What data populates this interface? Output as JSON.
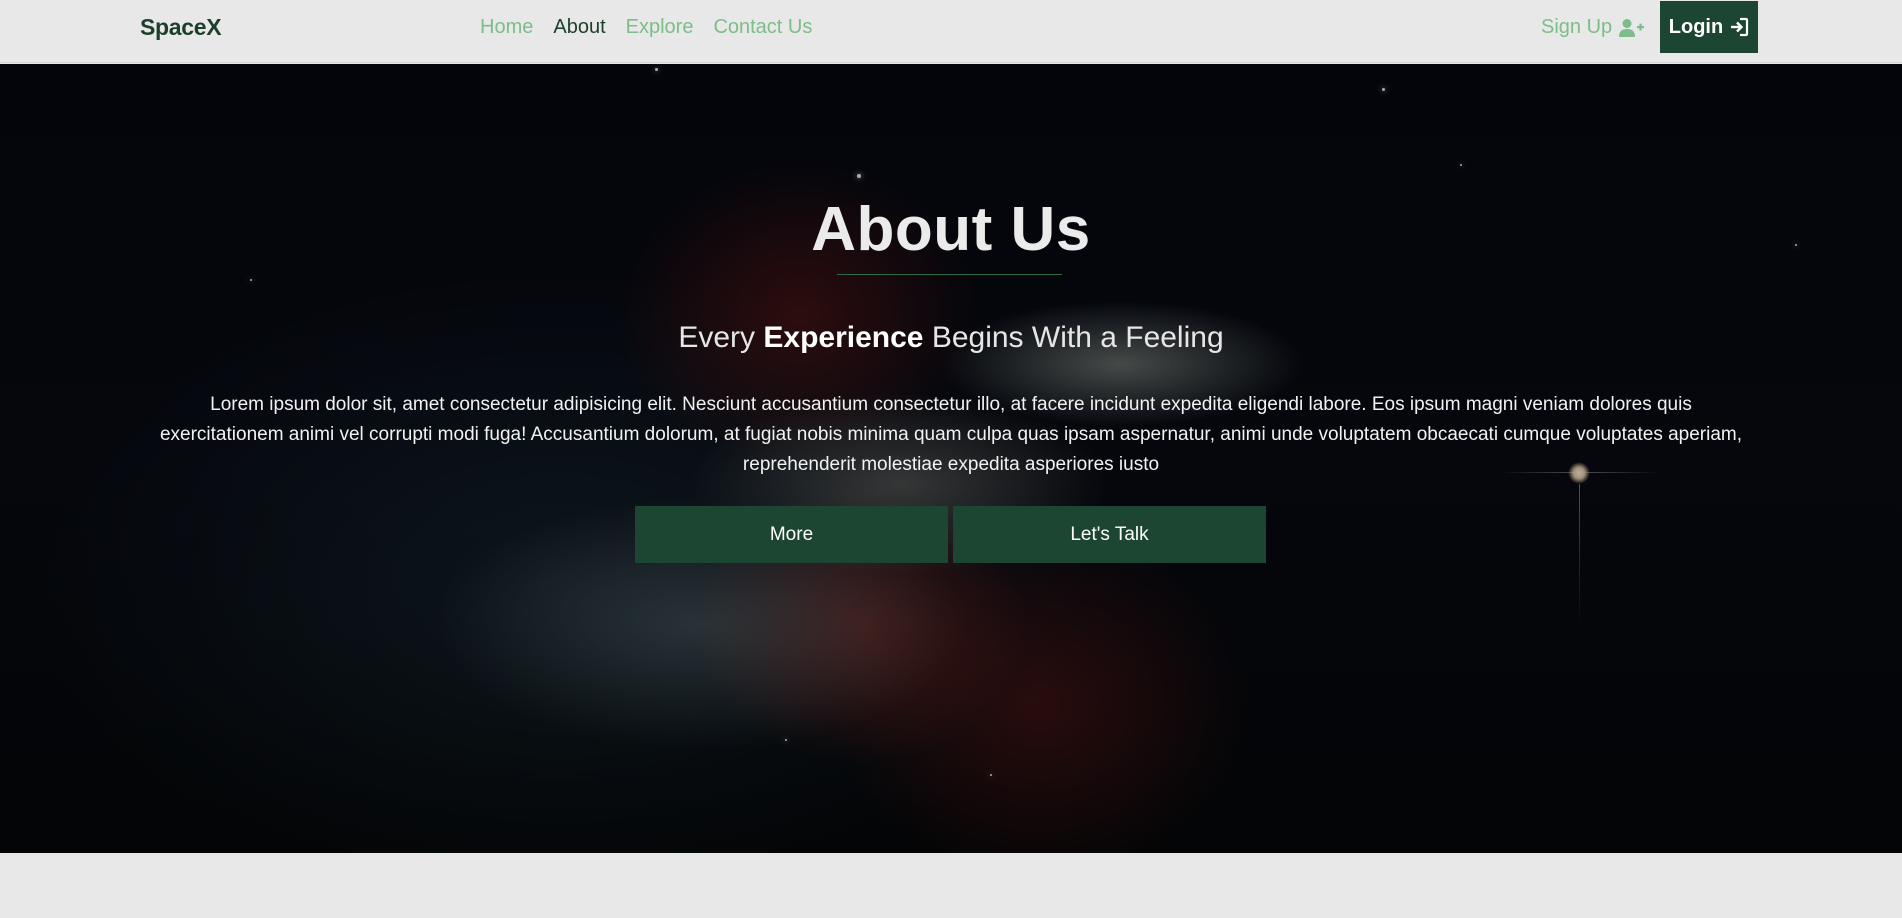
{
  "brand": "SpaceX",
  "nav": {
    "links": [
      {
        "label": "Home",
        "active": false
      },
      {
        "label": "About",
        "active": true
      },
      {
        "label": "Explore",
        "active": false
      },
      {
        "label": "Contact Us",
        "active": false
      }
    ],
    "signup_label": "Sign Up",
    "signup_icon": "user-plus-icon",
    "login_label": "Login",
    "login_icon": "sign-in-icon"
  },
  "hero": {
    "title": "About Us",
    "subtitle_pre": "Every ",
    "subtitle_strong": "Experience",
    "subtitle_post": " Begins With a Feeling",
    "text": "Lorem ipsum dolor sit, amet consectetur adipisicing elit. Nesciunt accusantium consectetur illo, at facere incidunt expedita eligendi labore. Eos ipsum magni veniam dolores quis exercitationem animi vel corrupti modi fuga! Accusantium dolorum, at fugiat nobis minima quam culpa quas ipsam aspernatur, animi unde voluptatem obcaecati cumque voluptates aperiam, reprehenderit molestiae expedita asperiores iusto",
    "buttons": {
      "more": "More",
      "talk": "Let's Talk"
    }
  },
  "colors": {
    "brand_green": "#1c3f2b",
    "button_green": "#1c4532",
    "link_green": "#7dbd8a",
    "background": "#e8e8e8"
  }
}
